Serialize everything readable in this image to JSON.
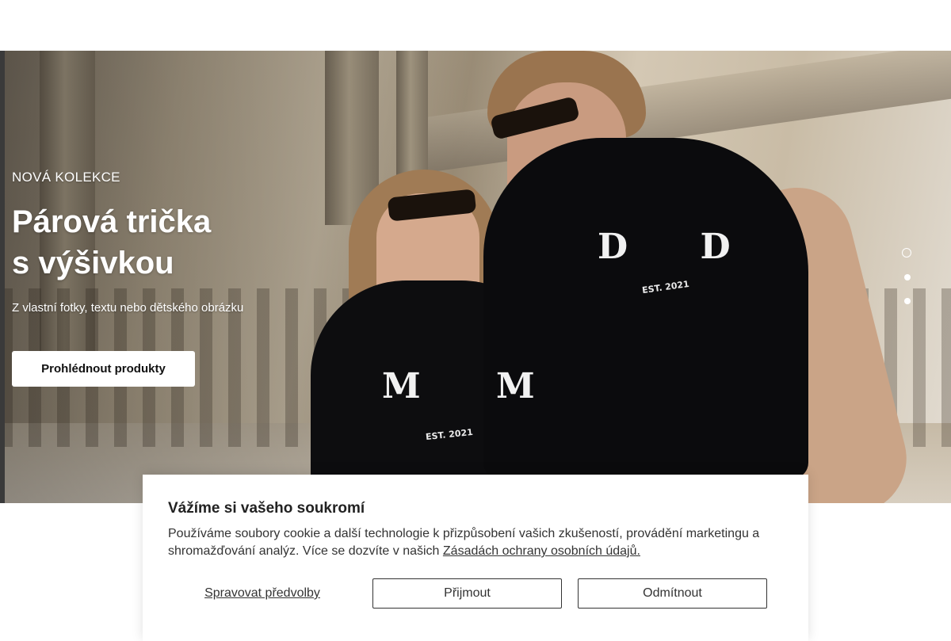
{
  "hero": {
    "eyebrow": "NOVÁ KOLEKCE",
    "headline_line1": "Párová trička",
    "headline_line2": "s výšivkou",
    "subtitle": "Z vlastní fotky, textu nebo dětského obrázku",
    "cta_label": "Prohlédnout produkty",
    "image_print_left": "M M",
    "image_print_right": "D D",
    "image_print_year": "EST. 2021",
    "slides": {
      "count": 3,
      "active_index": 0
    }
  },
  "cookie_banner": {
    "title": "Vážíme si vašeho soukromí",
    "text": "Používáme soubory cookie a další technologie k přizpůsobení vašich zkušeností, provádění marketingu a shromažďování analýz. Více se dozvíte v našich ",
    "link_text": "Zásadách ochrany osobních údajů.",
    "manage_label": "Spravovat předvolby",
    "accept_label": "Přijmout",
    "reject_label": "Odmítnout"
  },
  "colors": {
    "banner_background": "#ffffff",
    "cta_background": "#ffffff",
    "shirt": "#0d0d0f"
  }
}
